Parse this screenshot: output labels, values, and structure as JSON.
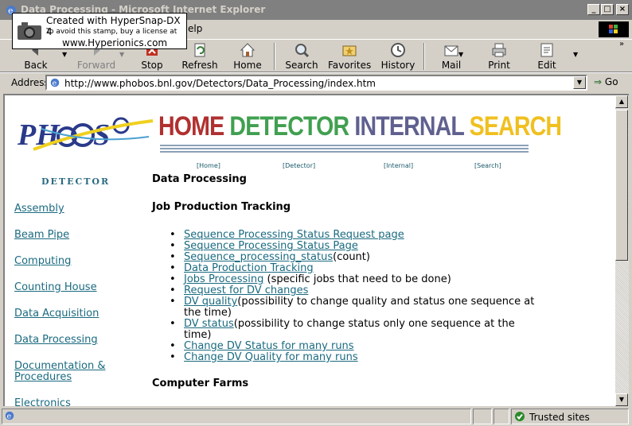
{
  "window": {
    "title": "Data Processing - Microsoft Internet Explorer"
  },
  "menu": {
    "visible_fragment": "elp"
  },
  "toolbar": {
    "back": "Back",
    "forward": "Forward",
    "stop": "Stop",
    "refresh": "Refresh",
    "home": "Home",
    "search": "Search",
    "favorites": "Favorites",
    "history": "History",
    "mail": "Mail",
    "print": "Print",
    "edit": "Edit"
  },
  "address": {
    "label": "Address",
    "url": "http://www.phobos.bnl.gov/Detectors/Data_Processing/index.htm",
    "go": "Go"
  },
  "stamp": {
    "line1": "Created with HyperSnap-DX 4",
    "line2": "To avoid this stamp, buy a license at",
    "line3": "www.Hyperionics.com"
  },
  "banner": {
    "items": [
      {
        "text": "HOME",
        "color": "#b03030"
      },
      {
        "text": "DETECTOR",
        "color": "#40a050"
      },
      {
        "text": "INTERNAL",
        "color": "#606090"
      },
      {
        "text": "SEARCH",
        "color": "#f0c020"
      }
    ]
  },
  "top_links": [
    "[Home]",
    "[Detector]",
    "[Internal]",
    "[Search]"
  ],
  "sidebar": {
    "heading": "DETECTOR",
    "items": [
      "Assembly",
      "Beam Pipe",
      "Computing",
      "Counting House",
      "Data Acquisition",
      "Data Processing",
      "Documentation &",
      "Procedures",
      "Electronics"
    ]
  },
  "main": {
    "title": "Data Processing",
    "section1": "Job Production Tracking",
    "section2": "Computer Farms",
    "jobs": [
      {
        "link": "Sequence Processing Status Request page",
        "note": ""
      },
      {
        "link": "Sequence Processing Status Page",
        "note": ""
      },
      {
        "link": "Sequence_processing_status",
        "note": "(count)"
      },
      {
        "link": "Data Production Tracking",
        "note": ""
      },
      {
        "link": "Jobs Processing",
        "note": " (specific jobs that need to be done)"
      },
      {
        "link": "Request for DV changes",
        "note": ""
      },
      {
        "link": "DV quality",
        "note": "(possibility to change quality and status one sequence at the time)"
      },
      {
        "link": "DV status",
        "note": "(possibility to change status only one sequence at the time)"
      },
      {
        "link": "Change DV Status for many runs",
        "note": ""
      },
      {
        "link": "Change DV Quality for many runs",
        "note": ""
      }
    ]
  },
  "status": {
    "zone": "Trusted sites"
  }
}
